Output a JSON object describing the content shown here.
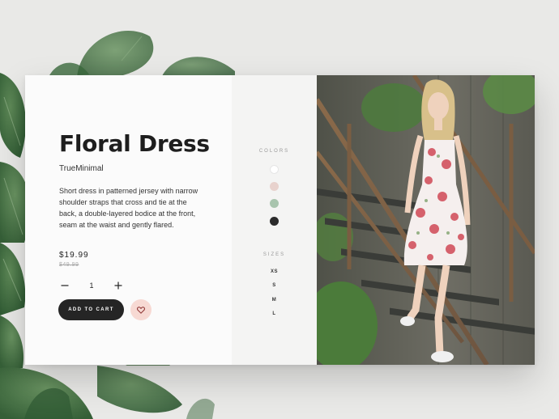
{
  "product": {
    "title": "Floral Dress",
    "brand": "TrueMinimal",
    "description": "Short dress in patterned jersey with narrow shoulder straps that cross and tie at the back, a double-layered bodice at the front, seam at the waist and gently flared.",
    "price": "$19.99",
    "old_price": "$49.99",
    "quantity": "1",
    "add_to_cart_label": "ADD TO CART"
  },
  "options": {
    "colors_label": "COLORS",
    "colors": [
      "#ffffff",
      "#e8d2cd",
      "#a8c4ad",
      "#2b2b2b"
    ],
    "sizes_label": "SIZES",
    "sizes": [
      "XS",
      "S",
      "M",
      "L"
    ]
  },
  "icons": {
    "minus": "minus-icon",
    "plus": "plus-icon",
    "heart": "heart-icon"
  },
  "colors": {
    "button_dark": "#252525",
    "wishlist_bg": "#f7d9d3",
    "heart_stroke": "#8b2f2f"
  }
}
